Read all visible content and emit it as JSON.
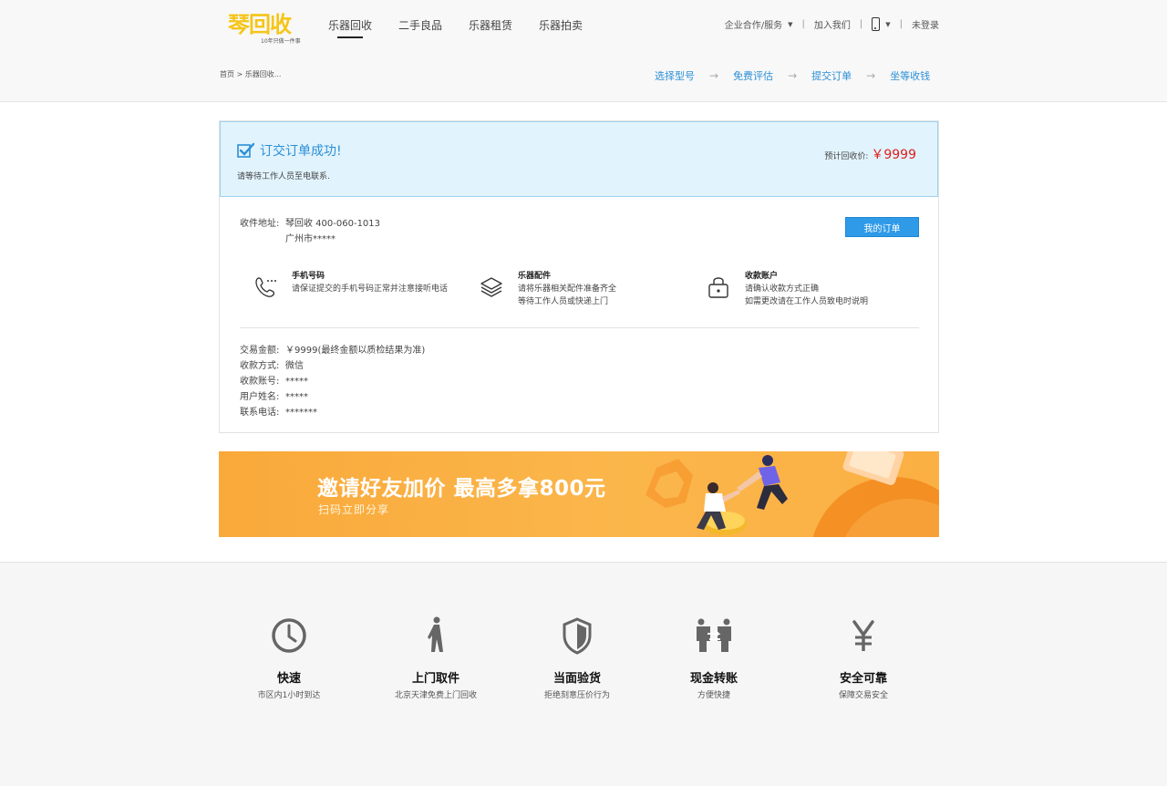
{
  "logo": {
    "text": "琴回收",
    "tagline": "10年只做一件事"
  },
  "nav": {
    "items": [
      {
        "label": "乐器回收",
        "active": true
      },
      {
        "label": "二手良品",
        "active": false
      },
      {
        "label": "乐器租赁",
        "active": false
      },
      {
        "label": "乐器拍卖",
        "active": false
      }
    ]
  },
  "top_right": {
    "enterprise": "企业合作/服务",
    "join": "加入我们",
    "separator": "|",
    "login": "未登录",
    "phone_icon": "mobile-phone-icon"
  },
  "breadcrumb": "首页 > 乐器回收...",
  "steps": {
    "items": [
      "选择型号",
      "免费评估",
      "提交订单",
      "坐等收钱"
    ],
    "arrow": "→"
  },
  "success": {
    "title": "订交订单成功!",
    "subtitle": "请等待工作人员至电联系.",
    "est_label": "预计回收价:",
    "est_price": "￥9999",
    "check_icon": "checkbox-check-icon"
  },
  "address": {
    "label": "收件地址:",
    "line1": "琴回收  400-060-1013",
    "line2": "广州市*****"
  },
  "my_order_button": "我的订单",
  "tips": [
    {
      "icon": "phone-call-icon",
      "title": "手机号码",
      "lines": [
        "请保证提交的手机号码正常并注意接听电话"
      ]
    },
    {
      "icon": "layers-icon",
      "title": "乐器配件",
      "lines": [
        "请将乐器相关配件准备齐全",
        "等待工作人员或快递上门"
      ]
    },
    {
      "icon": "lock-icon",
      "title": "收款账户",
      "lines": [
        "请确认收款方式正确",
        "如需更改请在工作人员致电时说明"
      ]
    }
  ],
  "info": [
    {
      "label": "交易金额:",
      "value": "￥9999(最终金额以质检结果为准)"
    },
    {
      "label": "收款方式:",
      "value": "微信"
    },
    {
      "label": "收款账号:",
      "value": "*****"
    },
    {
      "label": "用户姓名:",
      "value": "*****"
    },
    {
      "label": "联系电话:",
      "value": "*******"
    }
  ],
  "banner": {
    "title": "邀请好友加价  最高多拿800元",
    "subtitle": "扫码立即分享"
  },
  "features": [
    {
      "icon": "clock-icon",
      "title": "快速",
      "subtitle": "市区内1小时到达"
    },
    {
      "icon": "walking-person-icon",
      "title": "上门取件",
      "subtitle": "北京天津免费上门回收"
    },
    {
      "icon": "shield-icon",
      "title": "当面验货",
      "subtitle": "拒绝刻意压价行为"
    },
    {
      "icon": "transfer-icon",
      "title": "现金转账",
      "subtitle": "方便快捷"
    },
    {
      "icon": "yen-icon",
      "title": "安全可靠",
      "subtitle": "保障交易安全"
    }
  ],
  "colors": {
    "accent_blue": "#2b8fd6",
    "button_blue": "#2e9ae8",
    "price_red": "#e0201c",
    "logo_yellow": "#f5c518",
    "banner_orange": "#f9a93a"
  }
}
